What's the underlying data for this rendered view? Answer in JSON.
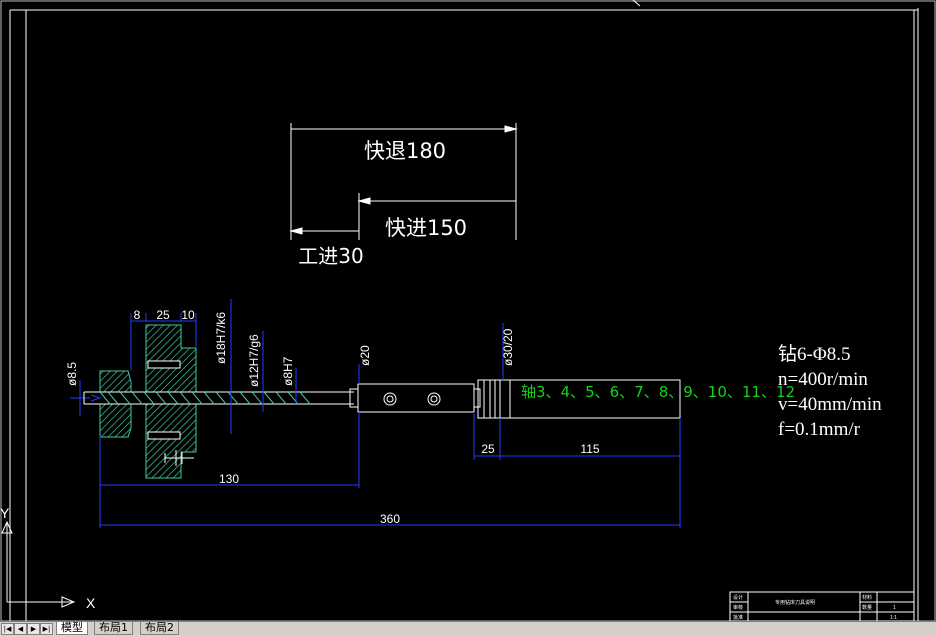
{
  "drawing": {
    "dims": {
      "fast_return": "快退180",
      "fast_feed": "快进150",
      "work_feed": "工进30",
      "d8": "8",
      "d25": "25",
      "d10": "10",
      "fit18": "ø18H7/k6",
      "fit12": "ø12H7/g6",
      "fit8": "ø8H7",
      "dia8_5": "ø8.5",
      "dia20": "ø20",
      "dia30": "ø30/20",
      "d25b": "25",
      "d115": "115",
      "d130": "130",
      "d360": "360"
    },
    "shaft_label": "轴3、4、5、6、7、8、9、10、11、12",
    "params": {
      "line1": "钻6-Φ8.5",
      "line2": "n=400r/min",
      "line3": "v=40mm/min",
      "line4": "f=0.1mm/r"
    },
    "ucs": {
      "x": "X",
      "y": "Y"
    },
    "title_block": {
      "cells": [
        "设计",
        "",
        "专用钻床刀具说明",
        "材料",
        "审核",
        "",
        "数量",
        "1",
        "批准",
        "",
        "1:1"
      ]
    },
    "colors": {
      "background": "#000000",
      "lines": "#ffffff",
      "dimensions": "#1e3cff",
      "green": "#16d216",
      "hatch": "#3fc7a3",
      "frame": "#ffffff"
    }
  },
  "tabs": {
    "model": "模型",
    "layout1": "布局1",
    "layout2": "布局2"
  }
}
